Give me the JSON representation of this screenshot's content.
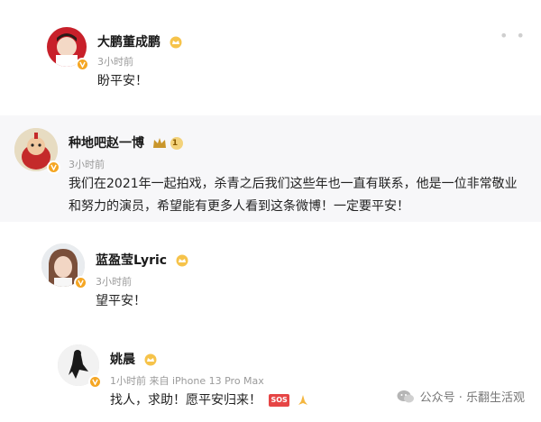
{
  "comments": [
    {
      "name": "大鹏董成鹏",
      "time": "3小时前",
      "text": "盼平安！"
    },
    {
      "name": "种地吧赵一博",
      "time": "3小时前",
      "text_line1": "我们在2021年一起拍戏，杀青之后我们这些年也一直有联系，他是一位非常敬业",
      "text_line2": "和努力的演员，希望能有更多人看到这条微博！一定要平安！",
      "level": "1"
    },
    {
      "name": "蓝盈莹Lyric",
      "time": "3小时前",
      "text": "望平安！"
    },
    {
      "name": "姚晨",
      "time": "1小时前 来自 iPhone 13 Pro Max",
      "text": "找人，求助！愿平安归来！",
      "sos": "SOS"
    }
  ],
  "watermark": {
    "text": "公众号 · 乐翻生活观"
  },
  "colors": {
    "badge_orange": "#f5a623",
    "meta_gray": "#9a9a9a",
    "highlight_bg": "#f7f7f9"
  }
}
